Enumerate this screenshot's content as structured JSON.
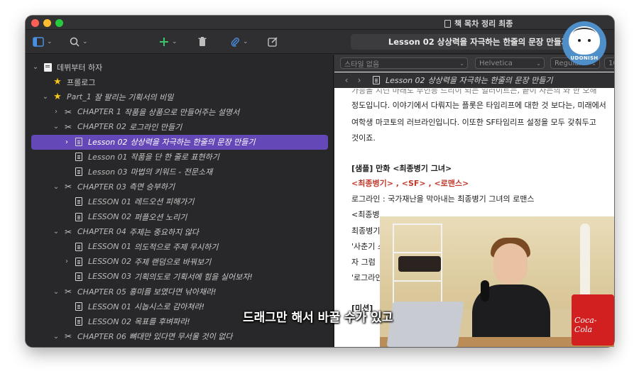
{
  "window": {
    "title": "책 목차 정리 최종"
  },
  "toolbar": {
    "document_title": "Lesson 02 상상력을 자극하는 한줄의 문장 만들기",
    "buttons": [
      "sidebar-toggle-icon",
      "search-icon",
      "add-icon",
      "trash-icon",
      "attach-icon",
      "compose-icon"
    ]
  },
  "format_bar": {
    "style_select": "스타일 없음",
    "font_select": "Helvetica",
    "weight_select": "Regular",
    "size_select": "10"
  },
  "path_bar": {
    "prefix": "Lesson 02",
    "title": "상상력을 자극하는 한줄의 문장 만들기"
  },
  "binder": {
    "rows": [
      {
        "prefix": "",
        "label": "데뷔부터 하자",
        "icon": "book",
        "disclosure": "open"
      },
      {
        "prefix": "",
        "label": "프롤로그",
        "icon": "star",
        "disclosure": "none"
      },
      {
        "prefix": "Part_1",
        "label": "잘 팔리는 기획서의 비밀",
        "icon": "star",
        "disclosure": "open"
      },
      {
        "prefix": "CHAPTER 1",
        "label": "작품을 상품으로 만들어주는 설명서",
        "icon": "scissors",
        "disclosure": "closed"
      },
      {
        "prefix": "CHAPTER 02",
        "label": "로그라인 만들기",
        "icon": "scissors",
        "disclosure": "open"
      },
      {
        "prefix": "Lesson 02",
        "label": "상상력을 자극하는 한줄의 문장 만들기",
        "icon": "page",
        "disclosure": "closed",
        "selected": true
      },
      {
        "prefix": "Lesson 01",
        "label": "작품을 단 한 줄로 표현하기",
        "icon": "page",
        "disclosure": "none"
      },
      {
        "prefix": "Lesson 03",
        "label": "마법의 키워드 - 전문소재",
        "icon": "page",
        "disclosure": "none"
      },
      {
        "prefix": "CHAPTER 03",
        "label": "측면 승부하기",
        "icon": "scissors",
        "disclosure": "open"
      },
      {
        "prefix": "LESSON 01",
        "label": "레드오션 피해가기",
        "icon": "page",
        "disclosure": "none"
      },
      {
        "prefix": "LESSON 02",
        "label": "퍼플오션 노리기",
        "icon": "page",
        "disclosure": "none"
      },
      {
        "prefix": "CHAPTER 04",
        "label": "주제는 중요하지 않다",
        "icon": "scissors",
        "disclosure": "open"
      },
      {
        "prefix": "LESSON 01",
        "label": "의도적으로 주제 무시하기",
        "icon": "page",
        "disclosure": "none"
      },
      {
        "prefix": "LESSON 02",
        "label": "주제 랜덤으로 바꿔보기",
        "icon": "page",
        "disclosure": "closed"
      },
      {
        "prefix": "LESSON 03",
        "label": "기획의도로 기획서에 힘을 실어보자!",
        "icon": "page",
        "disclosure": "none"
      },
      {
        "prefix": "CHAPTER 05",
        "label": "흥미를 보였다면 낚아채라!",
        "icon": "scissors",
        "disclosure": "open"
      },
      {
        "prefix": "LESSON 01",
        "label": "시놉시스로 감아쳐라!",
        "icon": "page",
        "disclosure": "none"
      },
      {
        "prefix": "LESSON 02",
        "label": "목표를 후벼파라!",
        "icon": "page",
        "disclosure": "none"
      },
      {
        "prefix": "CHAPTER 06",
        "label": "뼈대만 있다면 무서울 것이 없다",
        "icon": "scissors",
        "disclosure": "open"
      }
    ]
  },
  "document": {
    "lines": [
      {
        "text": "가능을 지닌 마래도 무인등 드리이 되는 일러이트는, 끝이 사는의 와 한 오해",
        "style": "cut"
      },
      {
        "text": "정도입니다. 이야기에서 다뤄지는 플롯은 타임리프에 대한 것 보다는, 미래에서",
        "style": "normal"
      },
      {
        "text": "여학생 마코토의 러브라인입니다. 이또한 SF타임리프 설정을 모두 갖춰두고",
        "style": "normal"
      },
      {
        "text": "것이죠.",
        "style": "normal"
      },
      {
        "text": "[샘플] 만화 <최종병기 그녀>",
        "style": "bold"
      },
      {
        "text": "<최종병기> , <SF> , <로맨스>",
        "style": "red"
      },
      {
        "text": "로그라인 : 국가재난을 막아내는 최종병기 그녀의 로맨스",
        "style": "normal"
      },
      {
        "text": "  <최종병",
        "style": "normal"
      },
      {
        "text": "최종병기",
        "style": "normal"
      },
      {
        "text": "'사춘기 소",
        "style": "normal"
      },
      {
        "text": "  자 그럼",
        "style": "normal"
      },
      {
        "text": "'로그라인",
        "style": "normal"
      },
      {
        "text": "[미션]",
        "style": "bold"
      }
    ]
  },
  "overlay": {
    "subtitle": "드래그만 해서 바꿀 수가 있고",
    "avatar_name": "UDONISH",
    "video_cola_text": "Coca-Cola"
  },
  "colors": {
    "selection": "#6548b8",
    "star": "#f5c518",
    "keyword_red": "#c0392b",
    "add_green": "#3ec46d",
    "attach_blue": "#4a90e2"
  }
}
